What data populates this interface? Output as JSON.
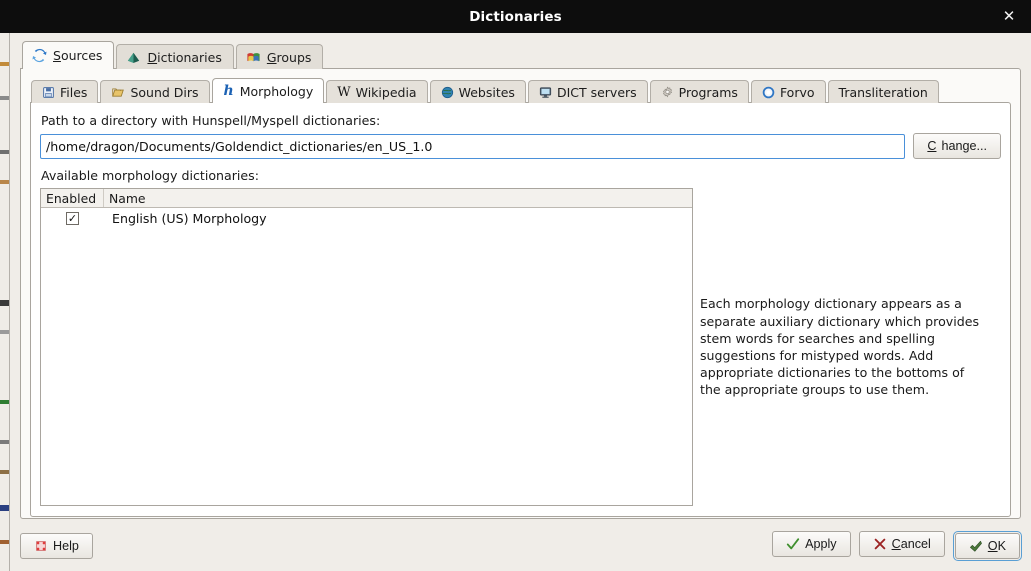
{
  "window": {
    "title": "Dictionaries",
    "close_label": "✕"
  },
  "tabs_primary": [
    {
      "label": "Sources",
      "icon": "sync-arrows-icon",
      "active": true,
      "accesskey": "S"
    },
    {
      "label": "Dictionaries",
      "icon": "book-icon",
      "active": false,
      "accesskey": "D"
    },
    {
      "label": "Groups",
      "icon": "books-stack-icon",
      "active": false,
      "accesskey": "G"
    }
  ],
  "tabs_secondary": [
    {
      "label": "Files",
      "icon": "floppy-disk-icon",
      "active": false
    },
    {
      "label": "Sound Dirs",
      "icon": "folder-icon",
      "active": false
    },
    {
      "label": "Morphology",
      "icon": "hunspell-h-icon",
      "active": true
    },
    {
      "label": "Wikipedia",
      "icon": "wikipedia-w-icon",
      "active": false
    },
    {
      "label": "Websites",
      "icon": "globe-icon",
      "active": false
    },
    {
      "label": "DICT servers",
      "icon": "monitor-icon",
      "active": false
    },
    {
      "label": "Programs",
      "icon": "gear-icon",
      "active": false
    },
    {
      "label": "Forvo",
      "icon": "forvo-ring-icon",
      "active": false
    },
    {
      "label": "Transliteration",
      "icon": "",
      "active": false
    }
  ],
  "morphology": {
    "path_label": "Path to a directory with Hunspell/Myspell dictionaries:",
    "path_value": "/home/dragon/Documents/Goldendict_dictionaries/en_US_1.0",
    "change_button": {
      "prefix": "C",
      "rest": "hange..."
    },
    "list_label": "Available morphology dictionaries:",
    "table": {
      "columns": [
        "Enabled",
        "Name"
      ],
      "rows": [
        {
          "enabled": true,
          "check_glyph": "✓",
          "name": "English (US) Morphology"
        }
      ]
    },
    "description": "Each morphology dictionary appears as a separate auxiliary dictionary which provides stem words for searches and spelling suggestions for mistyped words. Add appropriate dictionaries to the bottoms of the appropriate groups to use them."
  },
  "footer": {
    "help": {
      "label": "Help",
      "icon": "help-dots-icon"
    },
    "apply": {
      "label": "Apply",
      "icon": "green-check-icon"
    },
    "cancel": {
      "prefix": "C",
      "rest": "ancel",
      "icon": "red-x-icon"
    },
    "ok": {
      "prefix": "O",
      "rest": "K",
      "icon": "green-arrow-check-icon"
    }
  },
  "colors": {
    "titlebar_bg": "#0d0d0d",
    "dialog_bg": "#f0ede8",
    "panel_bg": "#ffffff",
    "focus_blue": "#4a90d9",
    "accent_blue": "#1c62b4",
    "ok_green": "#3f7a2e",
    "cancel_red": "#9c2323"
  }
}
